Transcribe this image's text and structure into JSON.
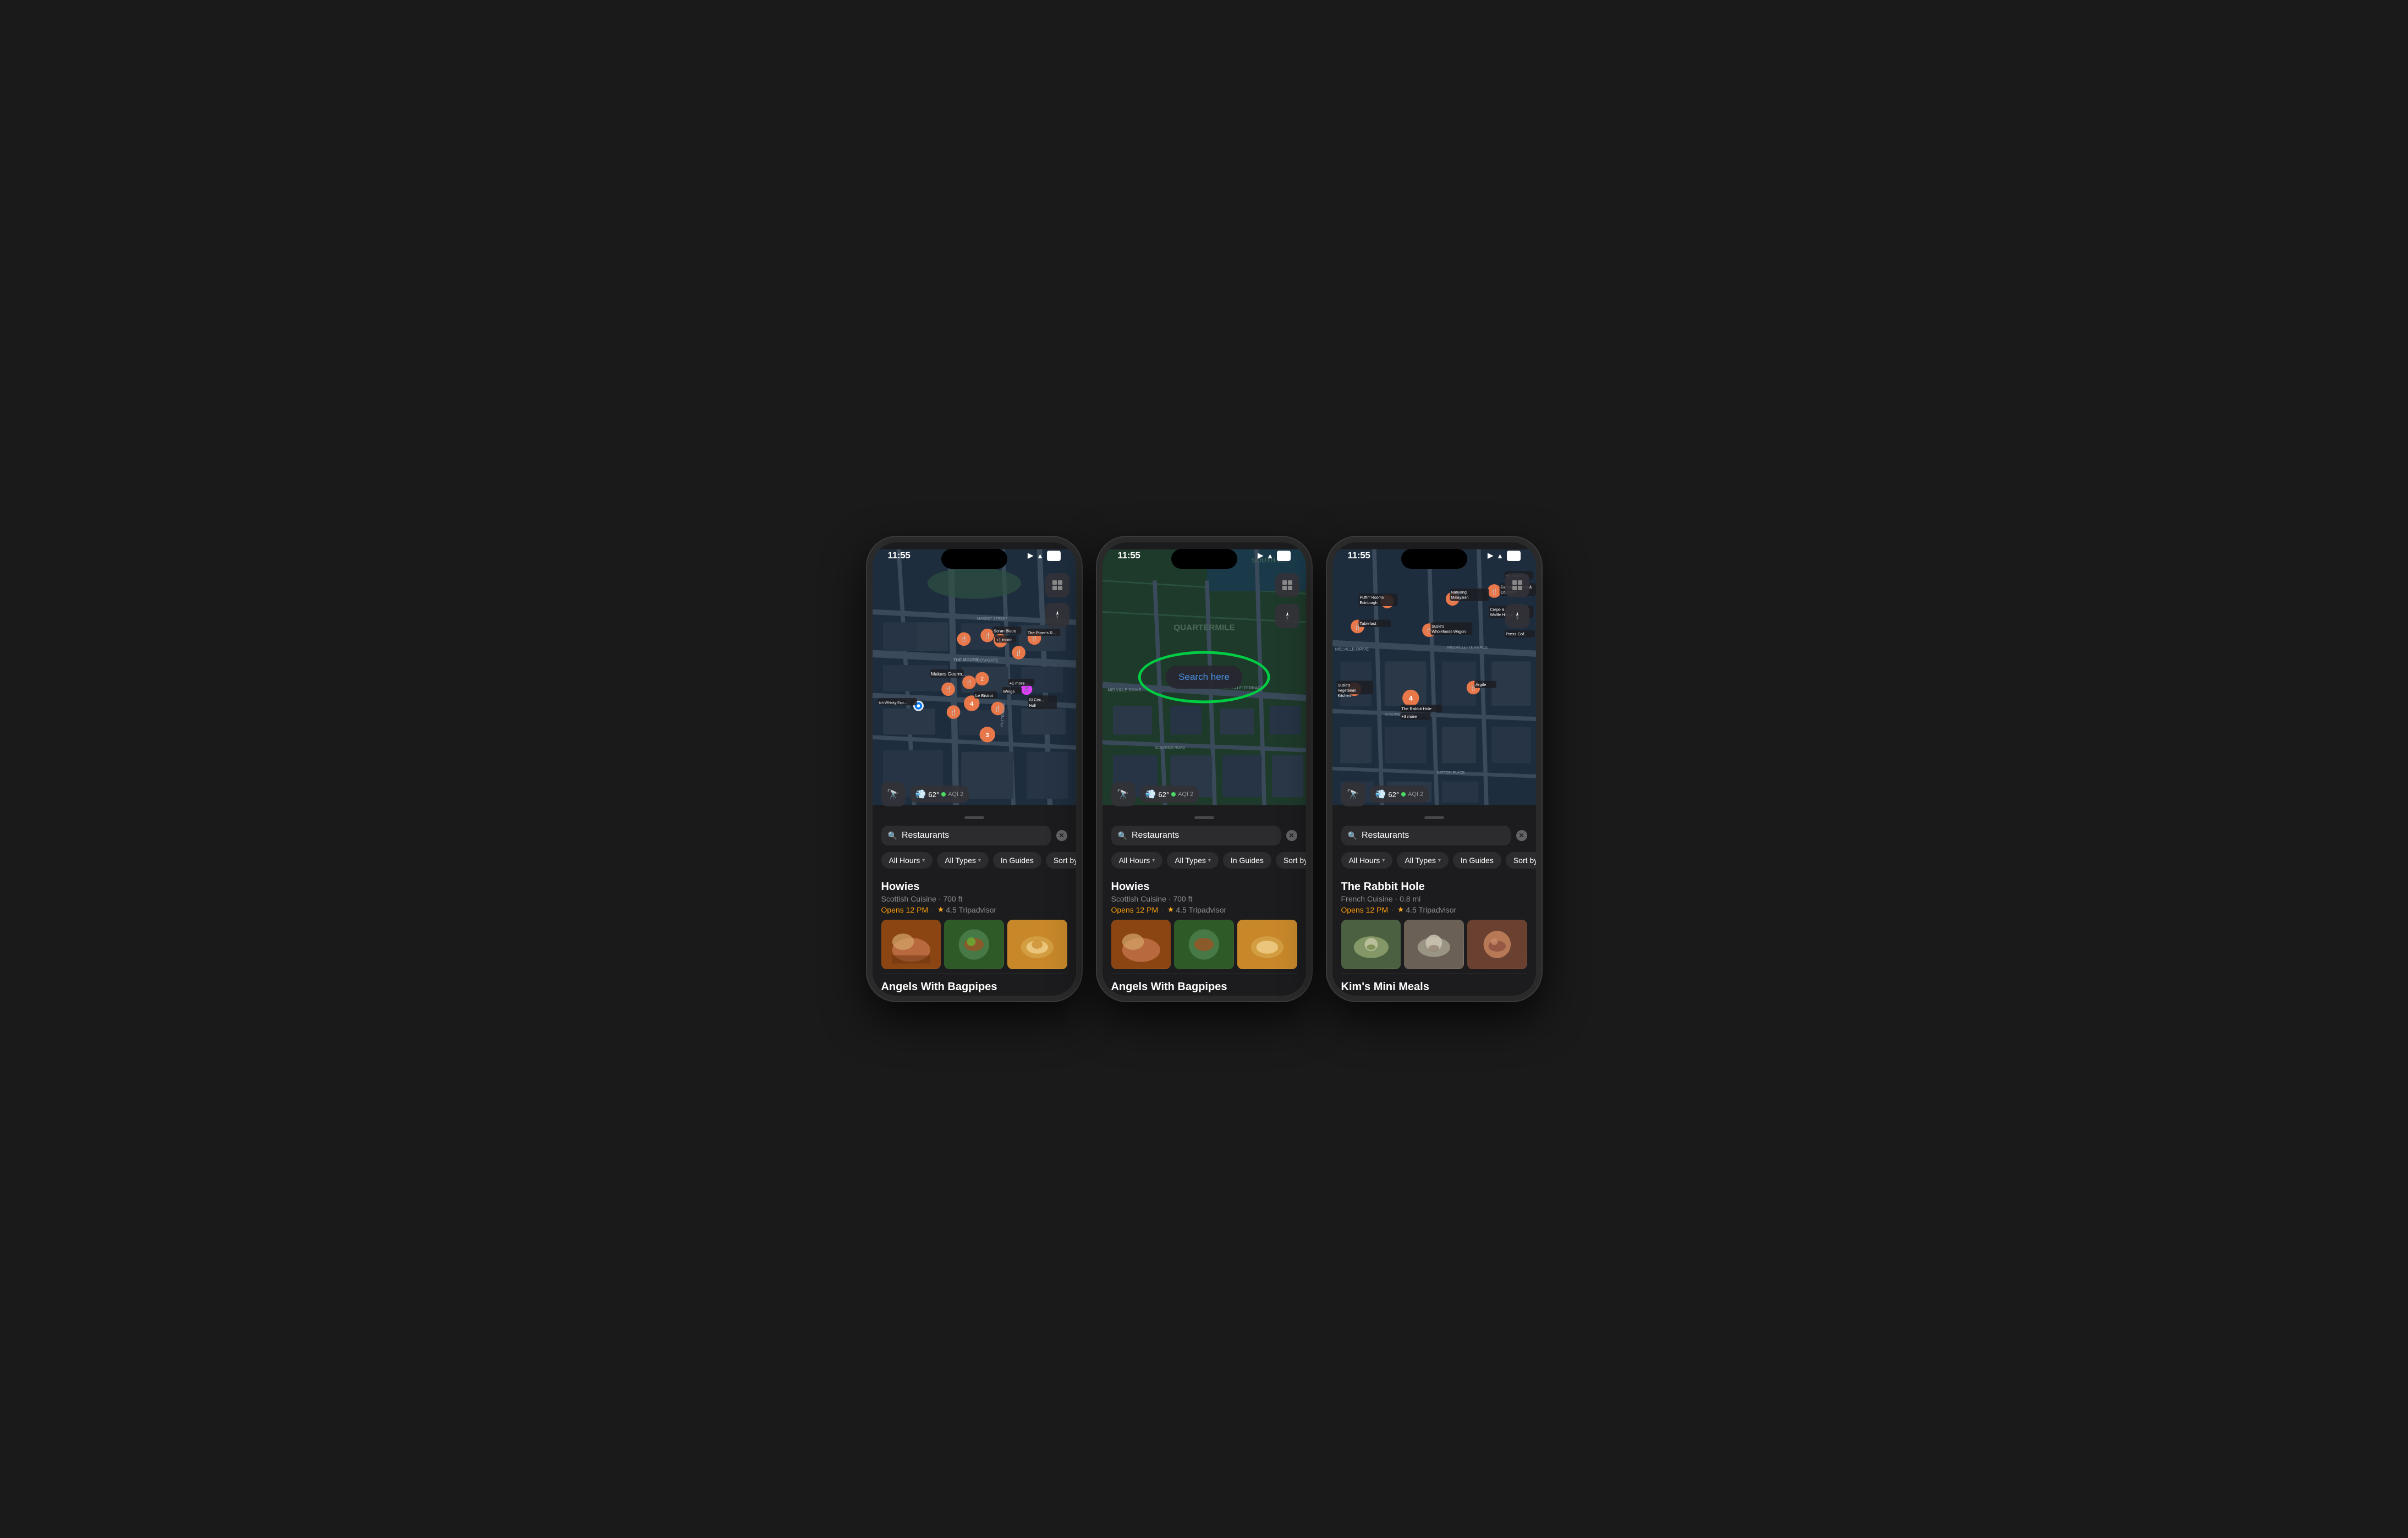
{
  "phones": [
    {
      "id": "phone1",
      "statusBar": {
        "time": "11:55",
        "locationIcon": true,
        "wifiIcon": true,
        "battery": "96"
      },
      "map": {
        "type": "edinburgh_old_town",
        "showSearchHere": false,
        "searchHereLabel": ""
      },
      "search": {
        "query": "Restaurants",
        "clearButton": "×"
      },
      "filters": [
        {
          "label": "All Hours",
          "hasChevron": true
        },
        {
          "label": "All Types",
          "hasChevron": true
        },
        {
          "label": "In Guides",
          "hasChevron": false
        },
        {
          "label": "Sort by",
          "hasChevron": false
        }
      ],
      "results": [
        {
          "name": "Howies",
          "subtitle": "Scottish Cuisine · 700 ft",
          "openStatus": "Opens 12 PM",
          "rating": "4.5 Tripadvisor",
          "photos": [
            "food1",
            "food2",
            "food3"
          ]
        }
      ],
      "nextResult": "Angels With Bagpipes",
      "weather": {
        "temp": "62°",
        "aqi": "AQI 2"
      }
    },
    {
      "id": "phone2",
      "statusBar": {
        "time": "11:55",
        "locationIcon": true,
        "wifiIcon": true,
        "battery": "96"
      },
      "map": {
        "type": "edinburgh_meadows",
        "showSearchHere": true,
        "searchHereLabel": "Search here"
      },
      "search": {
        "query": "Restaurants",
        "clearButton": "×"
      },
      "filters": [
        {
          "label": "All Hours",
          "hasChevron": true
        },
        {
          "label": "All Types",
          "hasChevron": true
        },
        {
          "label": "In Guides",
          "hasChevron": false
        },
        {
          "label": "Sort by",
          "hasChevron": false
        }
      ],
      "results": [
        {
          "name": "Howies",
          "subtitle": "Scottish Cuisine · 700 ft",
          "openStatus": "Opens 12 PM",
          "rating": "4.5 Tripadvisor",
          "photos": [
            "food1",
            "food2",
            "food3"
          ]
        }
      ],
      "nextResult": "Angels With Bagpipes",
      "weather": {
        "temp": "62°",
        "aqi": "AQI 2"
      }
    },
    {
      "id": "phone3",
      "statusBar": {
        "time": "11:55",
        "locationIcon": true,
        "wifiIcon": true,
        "battery": "96"
      },
      "map": {
        "type": "edinburgh_south",
        "showSearchHere": false,
        "searchHereLabel": ""
      },
      "search": {
        "query": "Restaurants",
        "clearButton": "×"
      },
      "filters": [
        {
          "label": "All Hours",
          "hasChevron": true
        },
        {
          "label": "All Types",
          "hasChevron": true
        },
        {
          "label": "In Guides",
          "hasChevron": false
        },
        {
          "label": "Sort by",
          "hasChevron": false
        }
      ],
      "results": [
        {
          "name": "The Rabbit Hole",
          "subtitle": "French Cuisine · 0.8 mi",
          "openStatus": "Opens 12 PM",
          "rating": "4.5 Tripadvisor",
          "photos": [
            "rabbit1",
            "rabbit2",
            "rabbit3"
          ]
        }
      ],
      "nextResult": "Kim's Mini Meals",
      "weather": {
        "temp": "62°",
        "aqi": "AQI 2"
      }
    }
  ],
  "icons": {
    "search": "🔍",
    "location_arrow": "➤",
    "map_icon": "🗺",
    "binoculars": "🔭",
    "wind": "💨",
    "star": "★"
  }
}
